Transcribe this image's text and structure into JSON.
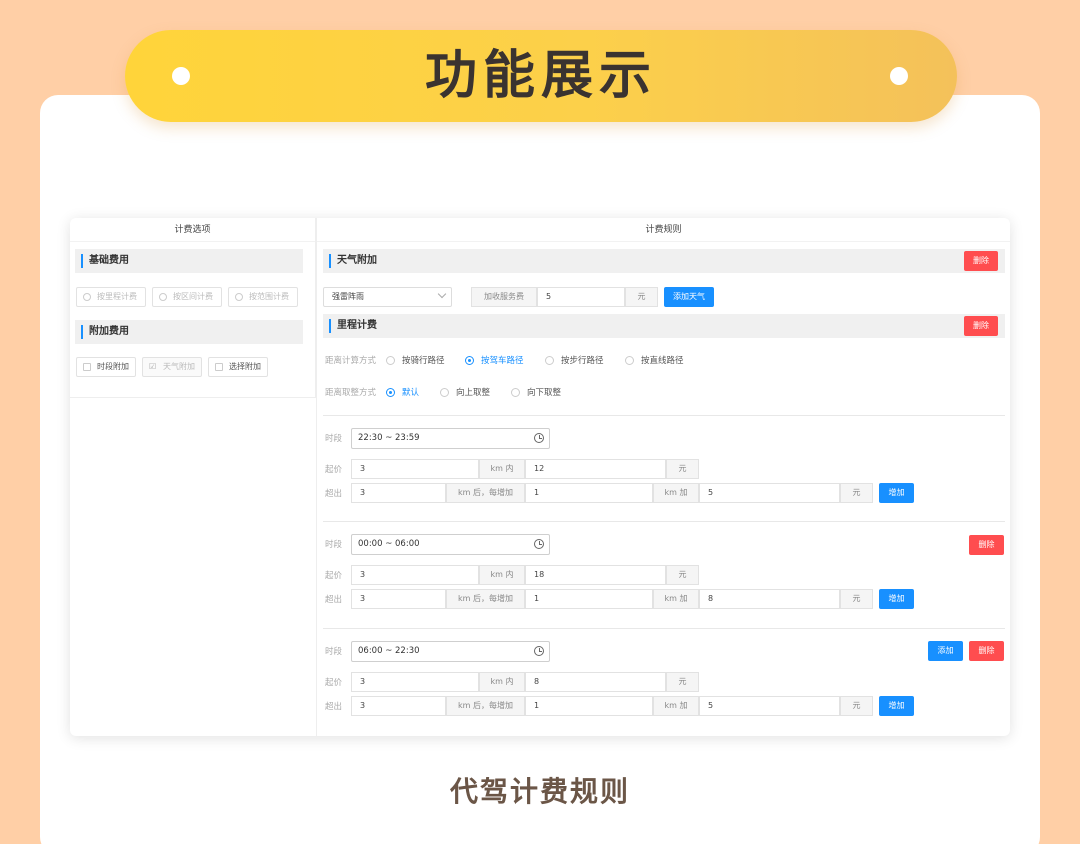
{
  "banner": {
    "title": "功能展示"
  },
  "caption": "代驾计费规则",
  "left": {
    "title": "计费选项",
    "basic": {
      "heading": "基础费用",
      "options": [
        "按里程计费",
        "按区间计费",
        "按范围计费"
      ]
    },
    "extra": {
      "heading": "附加费用",
      "options": [
        "时段附加",
        "天气附加",
        "选择附加"
      ]
    }
  },
  "right": {
    "title": "计费规则",
    "weather": {
      "heading": "天气附加",
      "delete_label": "删除",
      "select_value": "强雷阵雨",
      "service_fee_label": "加收服务费",
      "service_fee_value": "5",
      "unit": "元",
      "add_label": "添加天气"
    },
    "mileage": {
      "heading": "里程计费",
      "delete_label": "删除",
      "distance_method_label": "距离计算方式",
      "distance_methods": [
        "按骑行路径",
        "按驾车路径",
        "按步行路径",
        "按直线路径"
      ],
      "distance_method_selected": "按驾车路径",
      "rounding_label": "距离取整方式",
      "rounding_methods": [
        "默认",
        "向上取整",
        "向下取整"
      ],
      "rounding_selected": "默认"
    },
    "period_label": "时段",
    "start_label": "起价",
    "exceed_label": "超出",
    "km_within": "km 内",
    "km_after": "km 后，每增加",
    "km_add": "km 加",
    "yuan": "元",
    "increase_label": "增加",
    "delete_label": "删除",
    "add_label": "添加",
    "periods": [
      {
        "time": "22:30 ~ 23:59",
        "start_km": "3",
        "start_price": "12",
        "exceed_km": "3",
        "step_km": "1",
        "step_price": "5"
      },
      {
        "time": "00:00 ~ 06:00",
        "start_km": "3",
        "start_price": "18",
        "exceed_km": "3",
        "step_km": "1",
        "step_price": "8"
      },
      {
        "time": "06:00 ~ 22:30",
        "start_km": "3",
        "start_price": "8",
        "exceed_km": "3",
        "step_km": "1",
        "step_price": "5"
      }
    ]
  }
}
